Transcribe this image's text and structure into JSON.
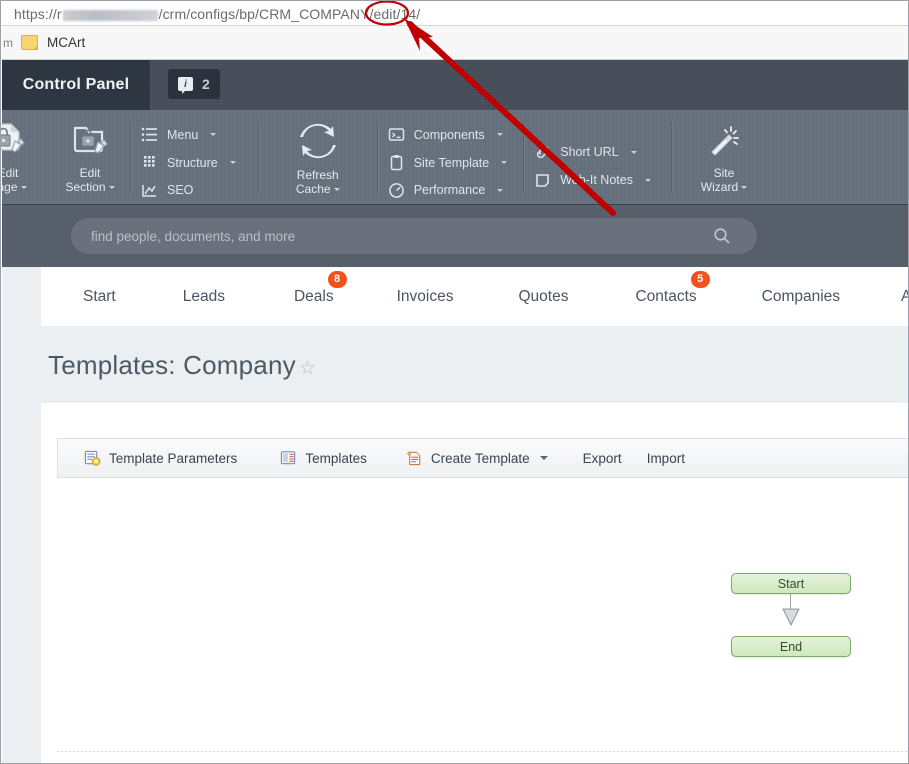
{
  "browser": {
    "url_prefix": "https://r",
    "url_redacted": true,
    "url_suffix": "/crm/configs/bp/CRM_COMPANY/edit/14/",
    "bookmark_partial": "m",
    "bookmark_label": "MCArt",
    "folder_icon": "folder-icon"
  },
  "control_panel": {
    "tab_label": "Control Panel",
    "info_icon": "info-icon",
    "info_count": "2"
  },
  "toolbar": {
    "big_buttons": [
      {
        "icon": "page-lock-edit-icon",
        "label_line1": "Edit",
        "label_line2": "Page",
        "caret": true
      },
      {
        "icon": "folder-lock-edit-icon",
        "label_line1": "Edit",
        "label_line2": "Section",
        "caret": true
      }
    ],
    "group_menu": [
      {
        "icon": "list-icon",
        "label": "Menu",
        "caret": true
      },
      {
        "icon": "grid-icon",
        "label": "Structure",
        "caret": true
      },
      {
        "icon": "chart-icon",
        "label": "SEO",
        "caret": false
      }
    ],
    "refresh": {
      "icon": "refresh-icon",
      "label_line1": "Refresh",
      "label_line2": "Cache",
      "caret": true
    },
    "group_components": [
      {
        "icon": "console-icon",
        "label": "Components",
        "caret": true
      },
      {
        "icon": "clipboard-icon",
        "label": "Site Template",
        "caret": true
      },
      {
        "icon": "gauge-icon",
        "label": "Performance",
        "caret": true
      }
    ],
    "group_url": [
      {
        "icon": "link-icon",
        "label": "Short URL",
        "caret": true
      },
      {
        "icon": "note-icon",
        "label": "Web-It Notes",
        "caret": true
      }
    ],
    "wizard": {
      "icon": "magic-wand-icon",
      "label_line1": "Site",
      "label_line2": "Wizard",
      "caret": true
    }
  },
  "search": {
    "placeholder": "find people, documents, and more",
    "value": "",
    "icon": "search-icon"
  },
  "nav": {
    "items": [
      {
        "label": "Start",
        "badge": ""
      },
      {
        "label": "Leads",
        "badge": ""
      },
      {
        "label": "Deals",
        "badge": "8"
      },
      {
        "label": "Invoices",
        "badge": ""
      },
      {
        "label": "Quotes",
        "badge": ""
      },
      {
        "label": "Contacts",
        "badge": "5"
      },
      {
        "label": "Companies",
        "badge": ""
      },
      {
        "label": "Activities",
        "badge": ""
      }
    ],
    "badge_color": "#f4511e"
  },
  "page": {
    "title": "Templates: Company",
    "favorite_icon": "star-outline-icon"
  },
  "actions": [
    {
      "icon": "template-parameters-icon",
      "label": "Template Parameters",
      "caret": false
    },
    {
      "icon": "templates-icon",
      "label": "Templates",
      "caret": false
    },
    {
      "icon": "create-template-icon",
      "label": "Create Template",
      "caret": true
    },
    {
      "icon": "",
      "label": "Export",
      "caret": false
    },
    {
      "icon": "",
      "label": "Import",
      "caret": false
    }
  ],
  "workflow": {
    "start_label": "Start",
    "end_label": "End",
    "node_fill": "#d9ecc8",
    "node_border": "#7da969",
    "connector_icon": "arrow-down-icon"
  },
  "annotation": {
    "highlight_target": "14/",
    "color": "#c00000",
    "arrow_icon": "arrow-pointer-icon",
    "ellipse_icon": "ellipse-highlight-icon"
  }
}
